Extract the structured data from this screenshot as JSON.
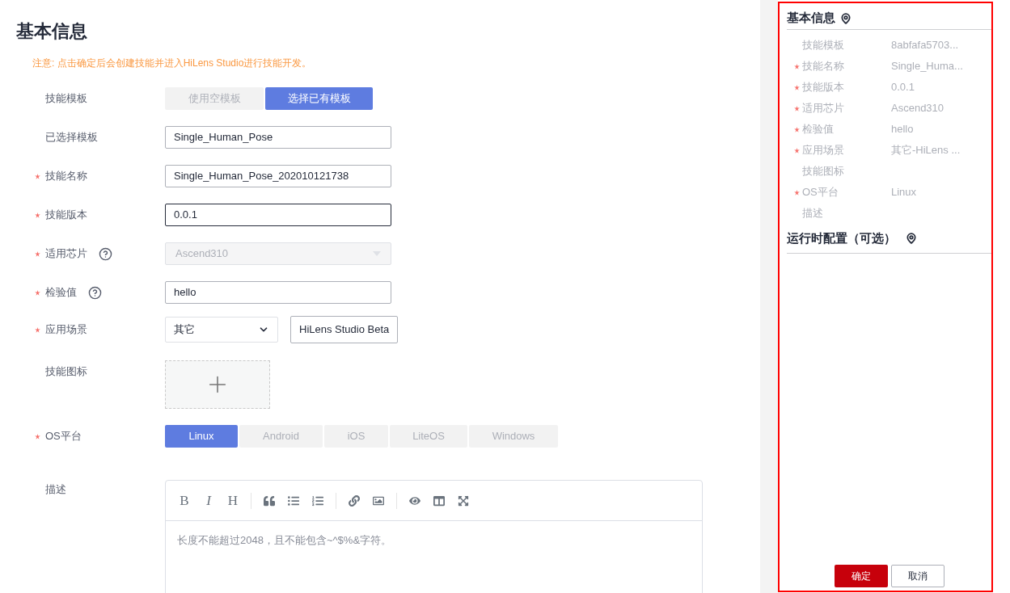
{
  "title": "基本信息",
  "notice": "注意: 点击确定后会创建技能并进入HiLens Studio进行技能开发。",
  "fields": [
    {
      "kind": "segmented",
      "label": "技能模板",
      "required": false,
      "help": false,
      "options": [
        {
          "label": "使用空模板",
          "selected": false
        },
        {
          "label": "选择已有模板",
          "selected": true
        }
      ]
    },
    {
      "kind": "input",
      "label": "已选择模板",
      "required": false,
      "help": false,
      "value": "Single_Human_Pose",
      "focused": false
    },
    {
      "kind": "input",
      "label": "技能名称",
      "required": true,
      "help": false,
      "value": "Single_Human_Pose_202010121738",
      "focused": false
    },
    {
      "kind": "input",
      "label": "技能版本",
      "required": true,
      "help": false,
      "value": "0.0.1",
      "focused": true
    },
    {
      "kind": "select",
      "label": "适用芯片",
      "required": true,
      "help": true,
      "value": "Ascend310",
      "disabled": true
    },
    {
      "kind": "input",
      "label": "检验值",
      "required": true,
      "help": true,
      "value": "hello",
      "focused": false
    },
    {
      "kind": "scene",
      "label": "应用场景",
      "required": true,
      "help": false,
      "value": "其它",
      "tag": "HiLens Studio Beta"
    },
    {
      "kind": "upload",
      "label": "技能图标",
      "required": false,
      "help": false
    },
    {
      "kind": "segmented",
      "label": "OS平台",
      "required": true,
      "help": false,
      "options": [
        {
          "label": "Linux",
          "selected": true
        },
        {
          "label": "Android",
          "selected": false
        },
        {
          "label": "iOS",
          "selected": false
        },
        {
          "label": "LiteOS",
          "selected": false
        },
        {
          "label": "Windows",
          "selected": false
        }
      ]
    },
    {
      "kind": "editor",
      "label": "描述",
      "required": false,
      "help": false,
      "placeholder": "长度不能超过2048，且不能包含~^$%&字符。",
      "toolbar": [
        {
          "kind": "letter",
          "label": "B"
        },
        {
          "kind": "letter",
          "label": "I",
          "italic": true
        },
        {
          "kind": "letter",
          "label": "H"
        },
        {
          "kind": "divider"
        },
        {
          "kind": "quote"
        },
        {
          "kind": "bullet-list"
        },
        {
          "kind": "numbered-list"
        },
        {
          "kind": "divider"
        },
        {
          "kind": "link"
        },
        {
          "kind": "image"
        },
        {
          "kind": "divider"
        },
        {
          "kind": "preview"
        },
        {
          "kind": "split"
        },
        {
          "kind": "fullscreen"
        }
      ]
    }
  ],
  "summary": {
    "title": "基本信息",
    "rows": [
      {
        "label": "技能模板",
        "required": false,
        "value": "8abfafa5703..."
      },
      {
        "label": "技能名称",
        "required": true,
        "value": "Single_Huma..."
      },
      {
        "label": "技能版本",
        "required": true,
        "value": "0.0.1"
      },
      {
        "label": "适用芯片",
        "required": true,
        "value": "Ascend310"
      },
      {
        "label": "检验值",
        "required": true,
        "value": "hello"
      },
      {
        "label": "应用场景",
        "required": true,
        "value": "其它-HiLens ..."
      },
      {
        "label": "技能图标",
        "required": false
      },
      {
        "label": "OS平台",
        "required": true,
        "value": "Linux"
      },
      {
        "label": "描述",
        "required": false
      }
    ],
    "runtime_title": "运行时配置（可选）",
    "buttons": [
      {
        "label": "确定",
        "kind": "primary"
      },
      {
        "label": "取消",
        "kind": "secondary"
      }
    ]
  }
}
